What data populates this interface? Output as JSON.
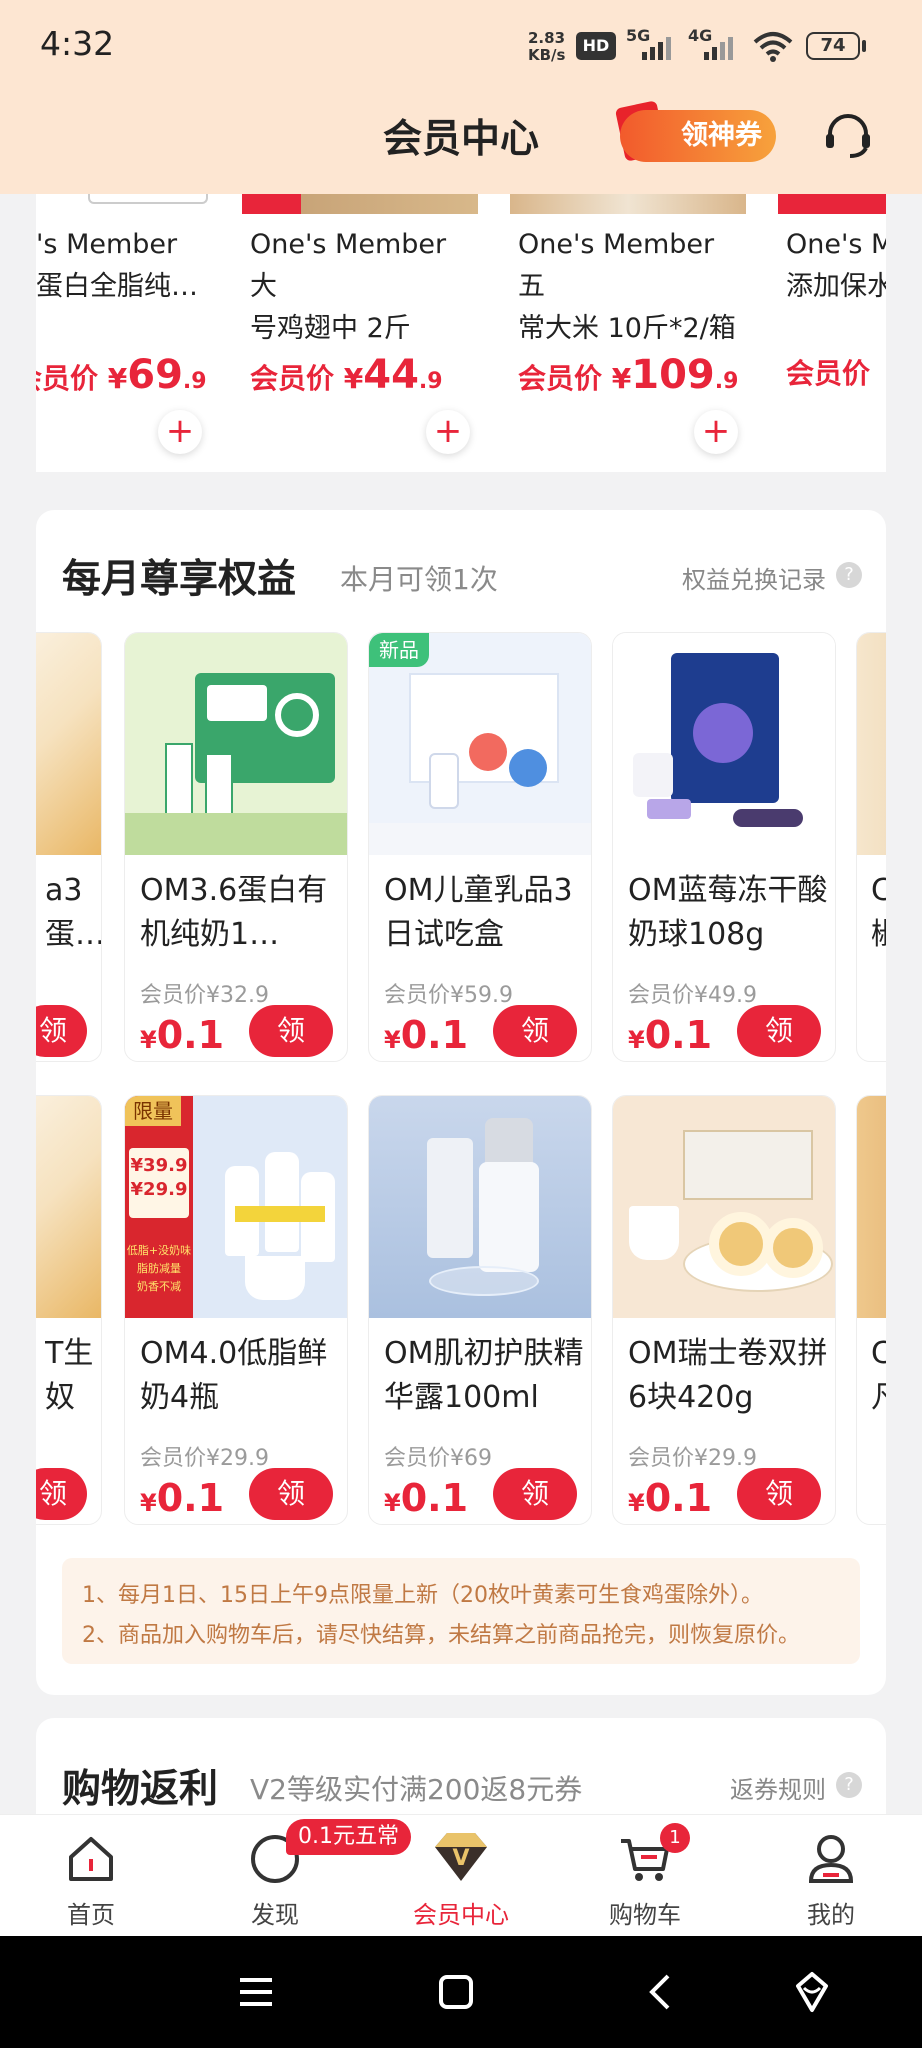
{
  "status_bar": {
    "time": "4:32",
    "net_speed": "2.83\nKB/s",
    "hd": "HD",
    "g5": "5G",
    "g4": "4G",
    "battery": "74"
  },
  "header": {
    "title": "会员中心",
    "coupon_btn": "领神券"
  },
  "top_products": [
    {
      "name": "'s Member\n蛋白全脂纯…",
      "price_label": "会员价",
      "yuan": "¥",
      "int": "69",
      "dec": ".9"
    },
    {
      "name": "One's Member 大\n号鸡翅中 2斤",
      "price_label": "会员价",
      "yuan": "¥",
      "int": "44",
      "dec": ".9"
    },
    {
      "name": "One's Member 五\n常大米 10斤*2/箱",
      "price_label": "会员价",
      "yuan": "¥",
      "int": "109",
      "dec": ".9"
    },
    {
      "name": "One's M\n添加保水",
      "price_label": "会员价",
      "yuan": "",
      "int": "",
      "dec": ""
    }
  ],
  "benefits": {
    "title": "每月尊享权益",
    "subtitle": "本月可领1次",
    "record_link": "权益兑换记录",
    "qmark": "?",
    "row1": [
      {
        "name": "OM3.6蛋白有机纯奶1…",
        "member_price": "会员价¥32.9",
        "special": "0.1",
        "btn": "领",
        "tag": ""
      },
      {
        "name": "OM儿童乳品3日试吃盒",
        "member_price": "会员价¥59.9",
        "special": "0.1",
        "btn": "领",
        "tag": "新品"
      },
      {
        "name": "OM蓝莓冻干酸奶球108g",
        "member_price": "会员价¥49.9",
        "special": "0.1",
        "btn": "领",
        "tag": ""
      }
    ],
    "row2": [
      {
        "name": "OM4.0低脂鲜奶4瓶",
        "member_price": "会员价¥29.9",
        "special": "0.1",
        "btn": "领",
        "tag": "限量"
      },
      {
        "name": "OM肌初护肤精华露100ml",
        "member_price": "会员价¥69",
        "special": "0.1",
        "btn": "领",
        "tag": ""
      },
      {
        "name": "OM瑞士卷双拼6块420g",
        "member_price": "会员价¥29.9",
        "special": "0.1",
        "btn": "领",
        "tag": ""
      }
    ],
    "partial_left_row1": "a3\n蛋…",
    "partial_left_row2": "T生\n奴",
    "partial_right_row1": "C\n椒",
    "partial_right_row2": "C\n凡",
    "yuan": "¥",
    "limited_poster": {
      "p1": "¥39.9",
      "p2": "¥29.9",
      "line1": "低脂+没奶味",
      "line2": "脂肪减量",
      "line3": "奶香不减"
    },
    "notes": [
      "1、每月1日、15日上午9点限量上新（20枚叶黄素可生食鸡蛋除外）。",
      "2、商品加入购物车后，请尽快结算，未结算之前商品抢完，则恢复原价。"
    ]
  },
  "rebate": {
    "title": "购物返利",
    "subtitle": "V2等级实付满200返8元券",
    "rule_link": "返券规则"
  },
  "nav": {
    "items": [
      "首页",
      "发现",
      "会员中心",
      "购物车",
      "我的"
    ],
    "discover_badge": "0.1元五常",
    "cart_badge": "1",
    "active_color": "#e8253a"
  }
}
